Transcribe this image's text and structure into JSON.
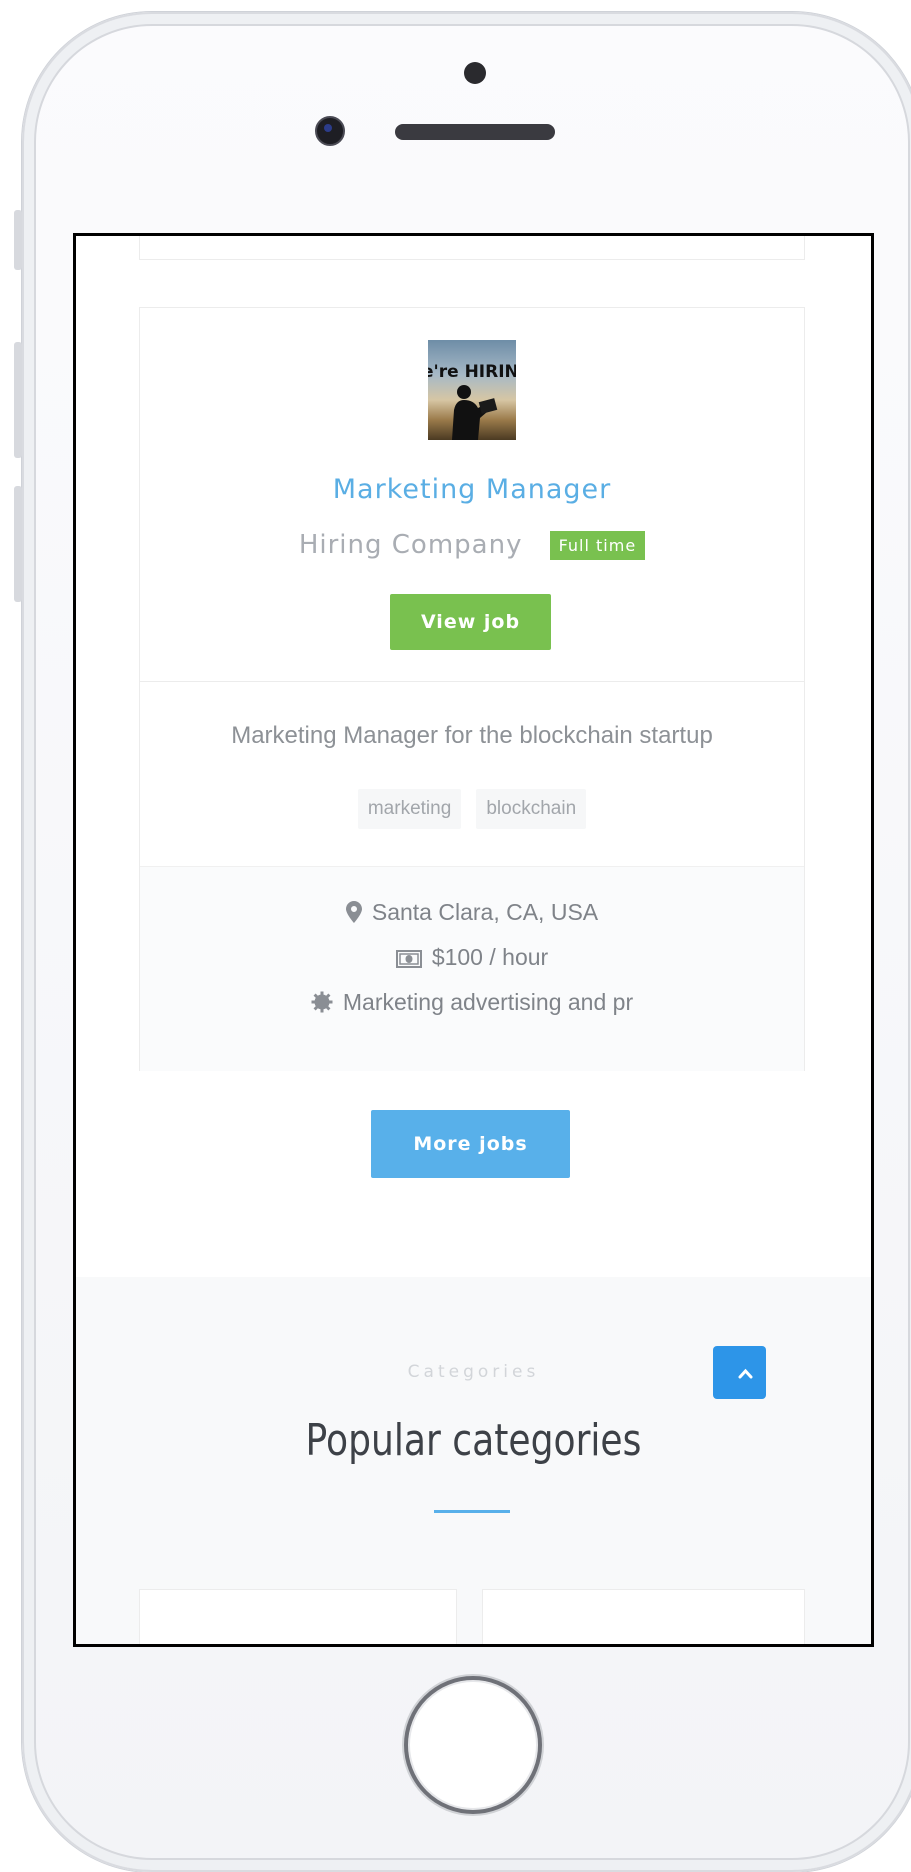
{
  "job": {
    "logo_text": "e're HIRIN",
    "title": "Marketing Manager",
    "company": "Hiring Company",
    "type_badge": "Full time",
    "view_label": "View job",
    "description": "Marketing Manager for the blockchain startup",
    "tags": [
      "marketing",
      "blockchain"
    ],
    "location": "Santa Clara, CA, USA",
    "salary": "$100 / hour",
    "category": "Marketing advertising and pr"
  },
  "more_jobs_label": "More jobs",
  "categories": {
    "eyebrow": "Categories",
    "title": "Popular categories"
  },
  "colors": {
    "accent_blue": "#58b0ea",
    "accent_green": "#79c14f",
    "scroll_top_blue": "#2d95e8"
  },
  "icons": {
    "location": "map-pin-icon",
    "salary": "money-icon",
    "category": "gear-icon",
    "scroll_top": "chevron-up-icon"
  }
}
